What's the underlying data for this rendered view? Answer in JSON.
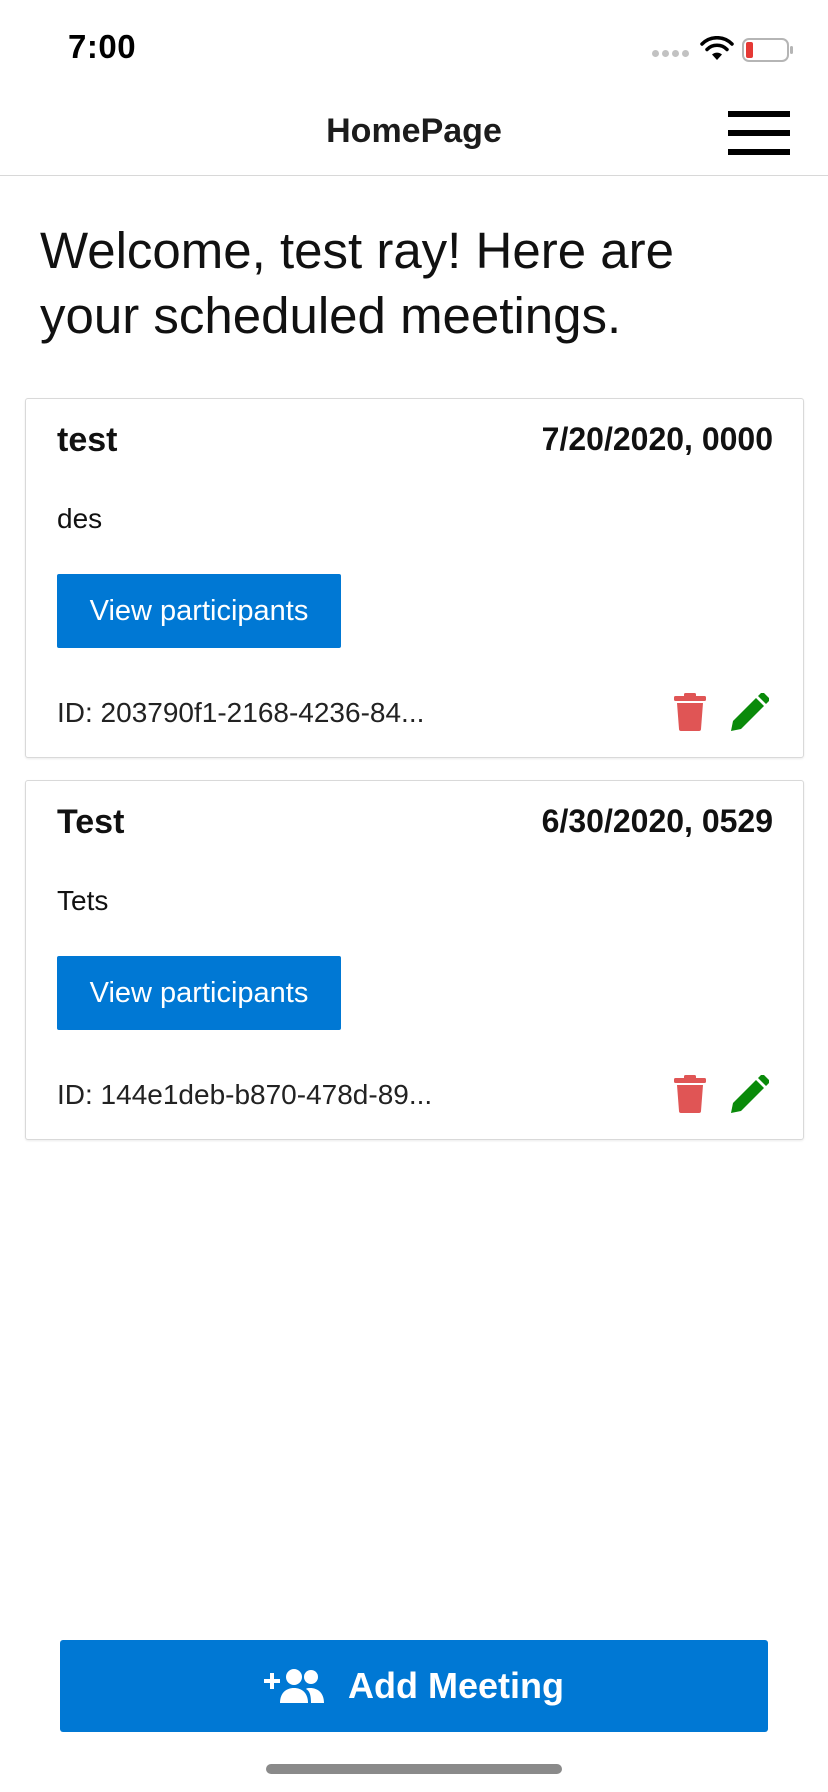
{
  "status_bar": {
    "time": "7:00",
    "battery_color": "#e53935"
  },
  "nav": {
    "title": "HomePage",
    "menu_icon": "hamburger-menu-icon"
  },
  "welcome_text": "Welcome, test ray! Here are your scheduled meetings.",
  "meetings": [
    {
      "title": "test",
      "date": "7/20/2020, 0000",
      "description": "des",
      "view_label": "View participants",
      "id_text": "ID: 203790f1-2168-4236-84..."
    },
    {
      "title": "Test",
      "date": "6/30/2020, 0529",
      "description": "Tets",
      "view_label": "View participants",
      "id_text": "ID: 144e1deb-b870-478d-89..."
    }
  ],
  "add_meeting": {
    "label": "Add Meeting",
    "icon": "add-people-icon"
  },
  "colors": {
    "primary": "#0078d4",
    "delete": "#e05555",
    "edit": "#0a8a0a"
  }
}
